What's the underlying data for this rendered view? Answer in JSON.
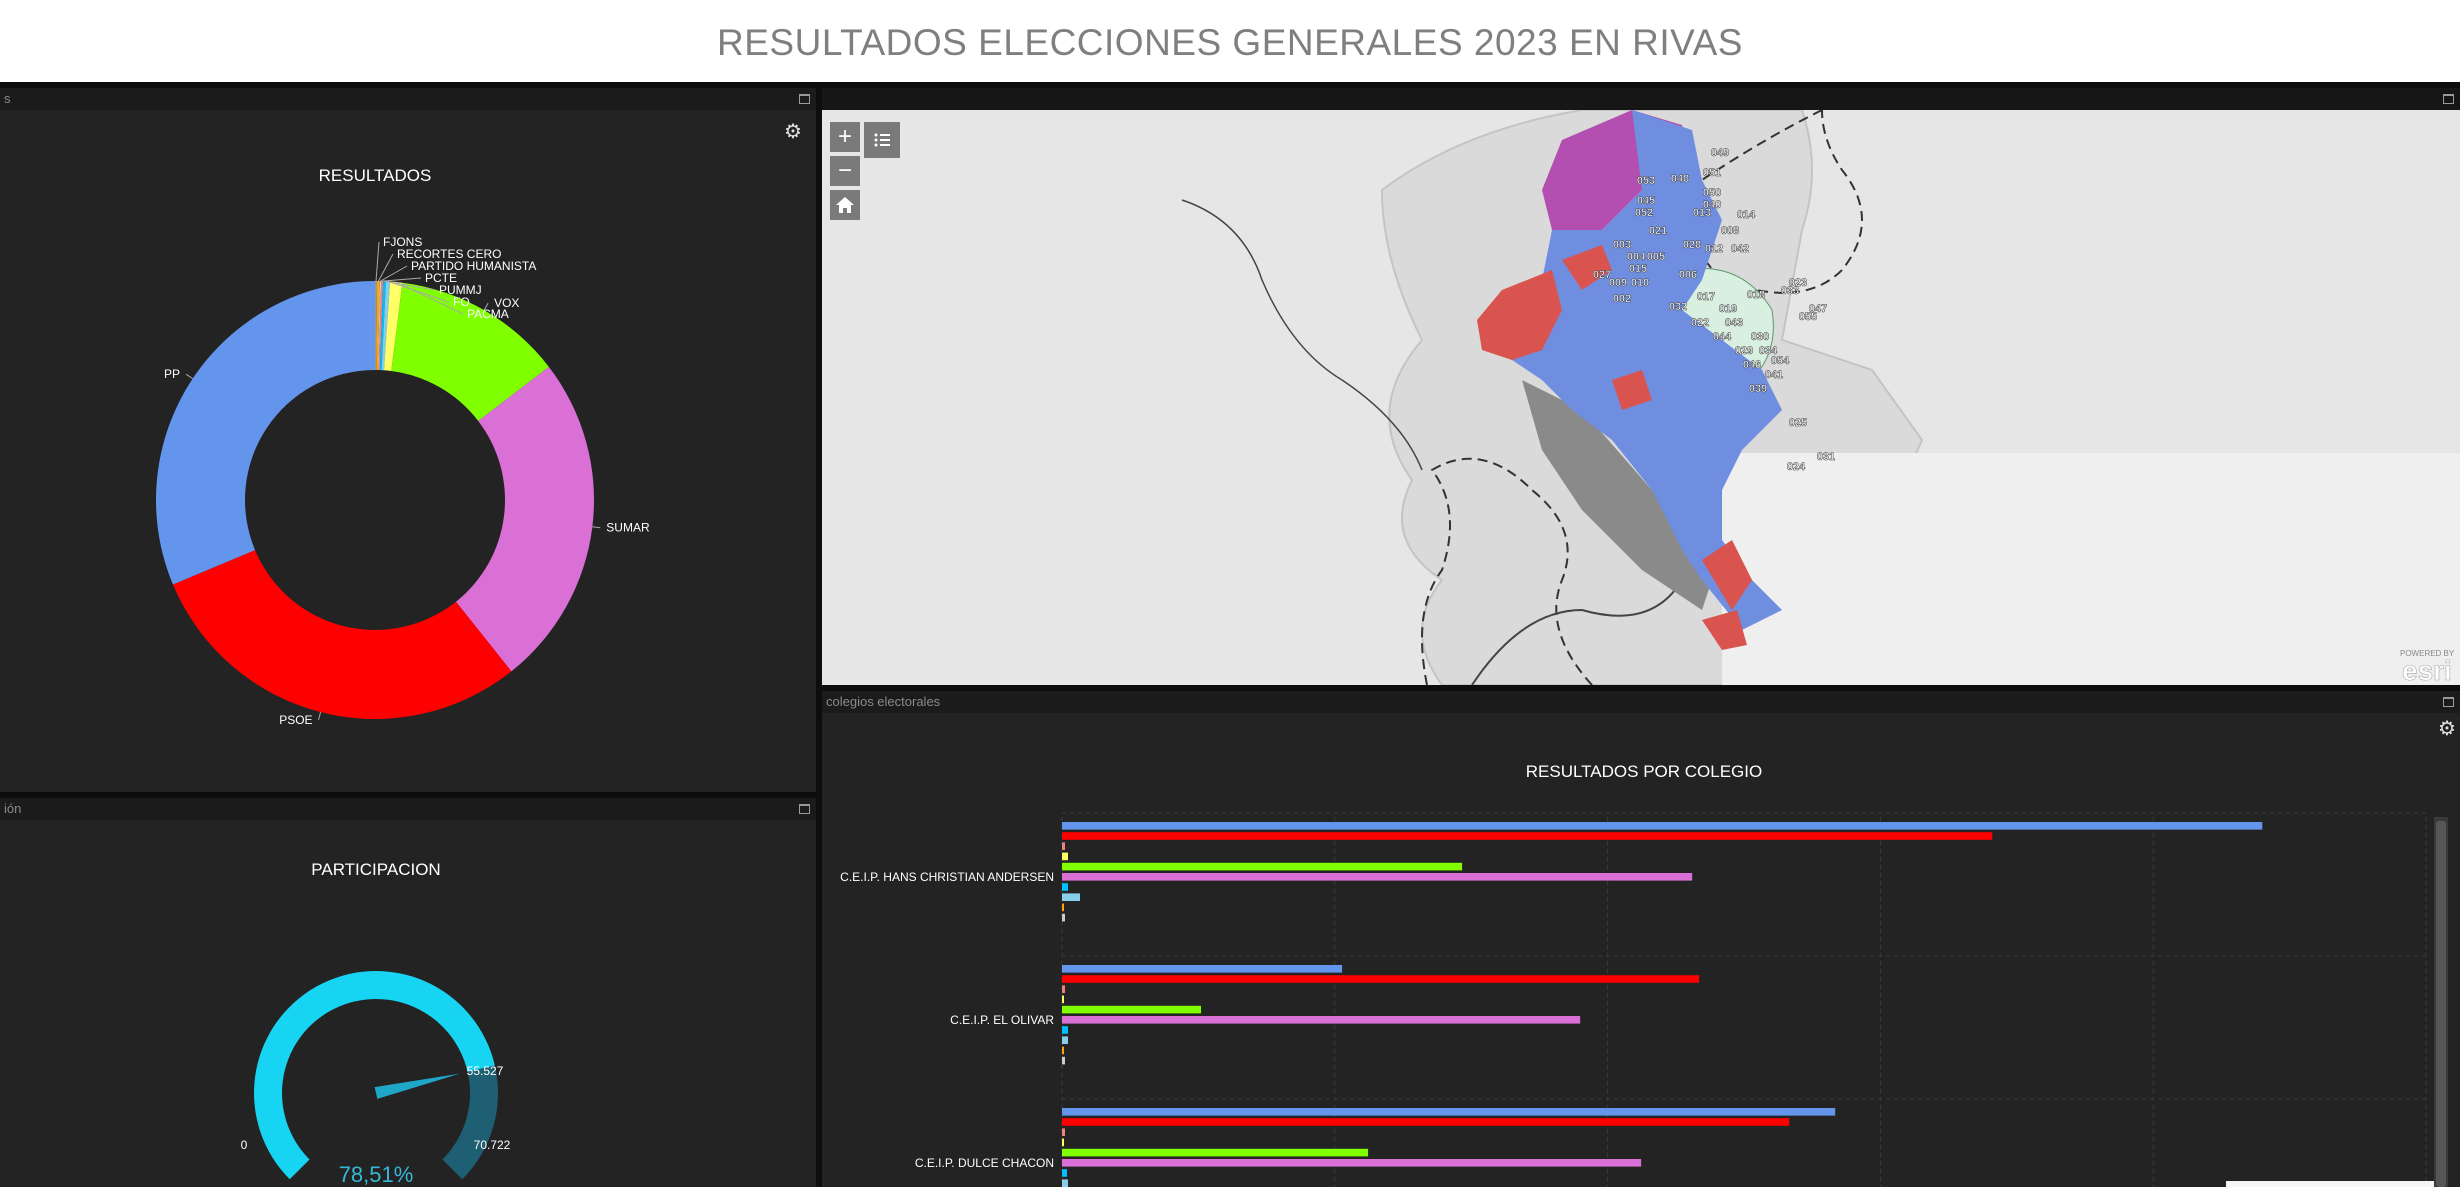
{
  "header": {
    "title": "RESULTADOS ELECCIONES GENERALES 2023 EN RIVAS"
  },
  "colors": {
    "PP": "#6495ed",
    "PSOE": "#ff0000",
    "SUMAR": "#da70d6",
    "VOX": "#7fff00",
    "PACMA": "#ffff66",
    "FO": "#87ceeb",
    "PUMMJ": "#00bfff",
    "PCTE": "#f08080",
    "PARTIDO HUMANISTA": "#cccccc",
    "RECORTES CERO": "#ffa500",
    "FJONS": "#999999"
  },
  "results_panel": {
    "header_label": "s",
    "chart_title": "RESULTADOS",
    "settings_icon": "gear-icon",
    "maximize_icon": "maximize-icon"
  },
  "participation_panel": {
    "header_label": "ión",
    "chart_title": "PARTICIPACION",
    "gauge_min": "0",
    "gauge_max": "70.722",
    "gauge_value_label": "55.527",
    "percent_label": "78,51%",
    "fraction": 0.7851
  },
  "map_panel": {
    "zoom_in_label": "+",
    "zoom_out_label": "−",
    "home_icon": "home-icon",
    "layers_icon": "layer-list-icon",
    "attribution": "POWERED BY",
    "logo_text": "esri",
    "section_labels": [
      "049",
      "053",
      "048",
      "051",
      "045",
      "050",
      "040",
      "052",
      "013",
      "014",
      "008",
      "021",
      "003",
      "028",
      "012",
      "042",
      "004",
      "005",
      "015",
      "027",
      "006",
      "023",
      "009",
      "010",
      "033",
      "018",
      "017",
      "002",
      "032",
      "019",
      "047",
      "022",
      "043",
      "055",
      "044",
      "030",
      "029",
      "034",
      "046",
      "054",
      "041",
      "039",
      "025",
      "031",
      "024"
    ]
  },
  "colleges_panel": {
    "header_label": "colegios electorales",
    "chart_title": "RESULTADOS POR COLEGIO",
    "settings_icon": "gear-icon"
  },
  "chart_data": [
    {
      "type": "pie",
      "title": "RESULTADOS",
      "donut": true,
      "slices": [
        {
          "name": "FJONS",
          "value": 0.15
        },
        {
          "name": "RECORTES CERO",
          "value": 0.2
        },
        {
          "name": "PARTIDO HUMANISTA",
          "value": 0.1
        },
        {
          "name": "PCTE",
          "value": 0.15
        },
        {
          "name": "PUMMJ",
          "value": 0.2
        },
        {
          "name": "FO",
          "value": 0.3
        },
        {
          "name": "PACMA",
          "value": 0.9
        },
        {
          "name": "VOX",
          "value": 12.6
        },
        {
          "name": "SUMAR",
          "value": 24.7
        },
        {
          "name": "PSOE",
          "value": 29.4
        },
        {
          "name": "PP",
          "value": 31.3
        }
      ]
    },
    {
      "type": "gauge",
      "title": "PARTICIPACION",
      "min": 0,
      "max": 70722,
      "value": 55527,
      "percent": "78,51%"
    },
    {
      "type": "bar",
      "orientation": "horizontal",
      "title": "RESULTADOS POR COLEGIO",
      "xlim": [
        0,
        1200
      ],
      "categories": [
        "C.E.I.P. HANS CHRISTIAN ANDERSEN",
        "C.E.I.P. EL OLIVAR",
        "C.E.I.P. DULCE CHACON"
      ],
      "series": [
        {
          "name": "PP",
          "values": [
            1200,
            280,
            773
          ]
        },
        {
          "name": "PSOE",
          "values": [
            930,
            637,
            727
          ]
        },
        {
          "name": "PCTE",
          "values": [
            3,
            3,
            3
          ]
        },
        {
          "name": "PACMA",
          "values": [
            6,
            2,
            2
          ]
        },
        {
          "name": "VOX",
          "values": [
            400,
            139,
            306
          ]
        },
        {
          "name": "SUMAR",
          "values": [
            630,
            518,
            579
          ]
        },
        {
          "name": "PUMMJ",
          "values": [
            6,
            6,
            5
          ]
        },
        {
          "name": "FO",
          "values": [
            18,
            6,
            6
          ]
        },
        {
          "name": "RECORTES CERO",
          "values": [
            1,
            1,
            1
          ]
        },
        {
          "name": "PARTIDO HUMANISTA",
          "values": [
            3,
            3,
            3
          ]
        }
      ]
    }
  ]
}
